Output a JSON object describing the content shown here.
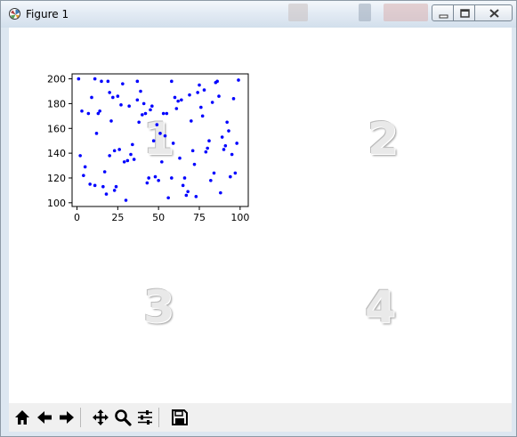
{
  "window": {
    "title": "Figure 1"
  },
  "window_buttons": {
    "minimize_icon": "minimize-icon",
    "maximize_icon": "maximize-icon",
    "close_icon": "close-icon"
  },
  "toolbar": {
    "buttons": [
      {
        "name": "home",
        "icon": "home-icon"
      },
      {
        "name": "back",
        "icon": "arrow-left-icon"
      },
      {
        "name": "forward",
        "icon": "arrow-right-icon"
      },
      {
        "name": "pan",
        "icon": "move-icon"
      },
      {
        "name": "zoom",
        "icon": "magnifier-icon"
      },
      {
        "name": "configure",
        "icon": "sliders-icon"
      },
      {
        "name": "save",
        "icon": "floppy-disk-icon"
      }
    ]
  },
  "subplot_labels": [
    "1",
    "2",
    "3",
    "4"
  ],
  "chart_data": {
    "type": "scatter",
    "title": "",
    "xlabel": "",
    "ylabel": "",
    "xlim": [
      -3,
      105
    ],
    "ylim": [
      97,
      204
    ],
    "xticks": [
      0,
      25,
      50,
      75,
      100
    ],
    "yticks": [
      100,
      120,
      140,
      160,
      180,
      200
    ],
    "grid": false,
    "color": "#0000ff",
    "series": [
      {
        "x": [
          1,
          2,
          3,
          4,
          5,
          7,
          8,
          9,
          11,
          11,
          12,
          13,
          14,
          15,
          16,
          17,
          18,
          19,
          20,
          20,
          21,
          22,
          23,
          23,
          24,
          25,
          26,
          27,
          28,
          29,
          30,
          31,
          32,
          33,
          34,
          35,
          37,
          37,
          38,
          39,
          40,
          41,
          42,
          43,
          44,
          45,
          46,
          47,
          48,
          49,
          50,
          51,
          52,
          53,
          54,
          55,
          56,
          58,
          58,
          59,
          60,
          61,
          62,
          63,
          64,
          65,
          66,
          67,
          68,
          69,
          70,
          71,
          72,
          73,
          74,
          75,
          76,
          77,
          78,
          79,
          80,
          81,
          82,
          83,
          84,
          85,
          86,
          87,
          88,
          89,
          90,
          91,
          92,
          93,
          94,
          95,
          96,
          97,
          98,
          99
        ],
        "y": [
          200,
          138,
          174,
          122,
          129,
          172,
          115,
          185,
          200,
          114,
          156,
          172,
          174,
          198,
          113,
          125,
          107,
          198,
          138,
          189,
          166,
          185,
          110,
          142,
          113,
          186,
          143,
          179,
          196,
          133,
          102,
          134,
          178,
          139,
          147,
          135,
          198,
          183,
          165,
          190,
          171,
          180,
          172,
          116,
          120,
          175,
          178,
          150,
          121,
          163,
          118,
          156,
          133,
          172,
          154,
          172,
          104,
          120,
          198,
          148,
          185,
          176,
          182,
          136,
          183,
          114,
          120,
          106,
          109,
          187,
          166,
          142,
          131,
          105,
          189,
          195,
          177,
          170,
          191,
          141,
          144,
          150,
          118,
          181,
          124,
          197,
          198,
          186,
          108,
          153,
          143,
          146,
          165,
          158,
          121,
          139,
          184,
          124,
          148,
          199
        ]
      }
    ]
  }
}
